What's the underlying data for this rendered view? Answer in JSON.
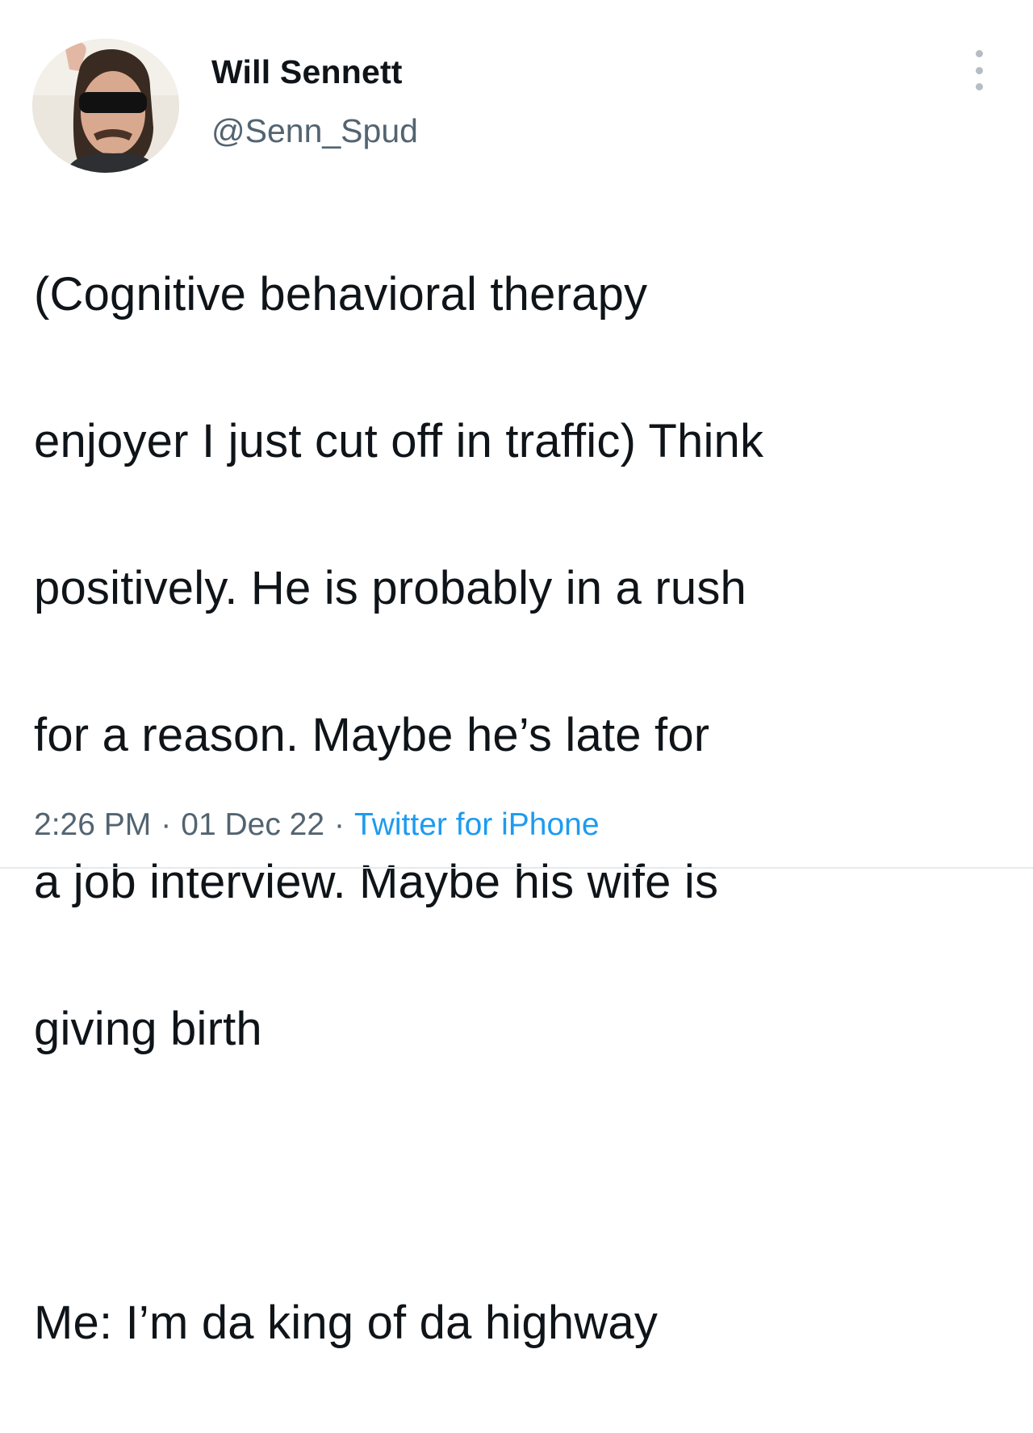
{
  "author": {
    "display_name": "Will Sennett",
    "handle": "@Senn_Spud"
  },
  "tweet": {
    "lines": [
      "(Cognitive behavioral therapy",
      "enjoyer I just cut off in traffic) Think",
      "positively. He is probably in a rush",
      "for a reason. Maybe he’s late for",
      "a job interview. Maybe his wife is",
      "giving birth",
      "Me: I’m da king of da highway"
    ]
  },
  "meta": {
    "time": "2:26 PM",
    "separator": "·",
    "date": "01 Dec 22",
    "source": "Twitter for iPhone"
  },
  "icons": {
    "more": "more-vertical-icon"
  },
  "colors": {
    "text": "#0f1419",
    "secondary": "#536471",
    "link": "#1d9bf0"
  }
}
